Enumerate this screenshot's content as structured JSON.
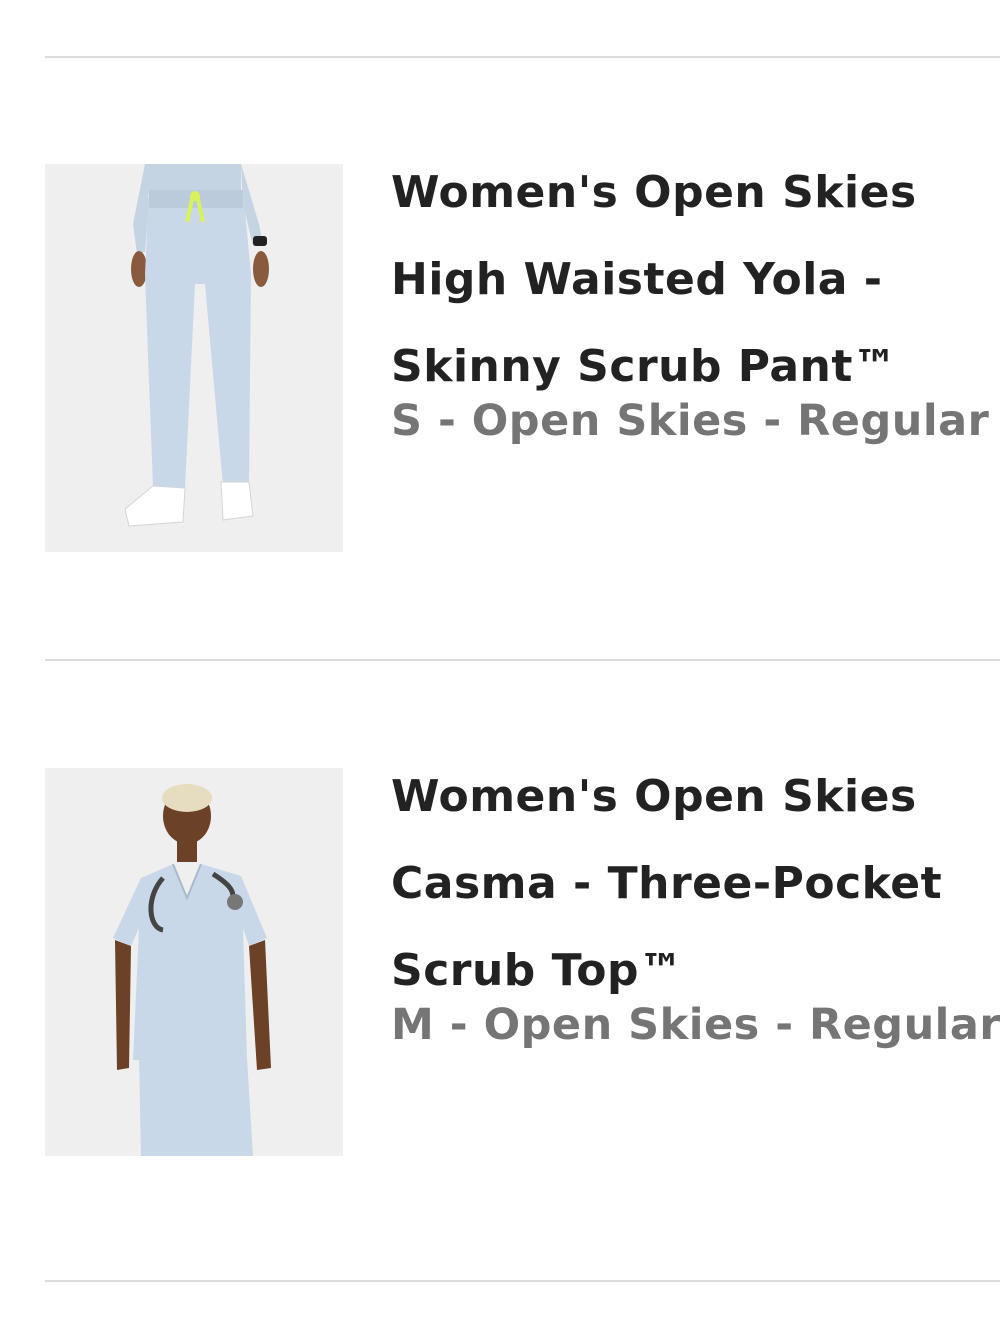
{
  "colors": {
    "title": "#222222",
    "variant": "#757575",
    "divider": "#dcdcdc",
    "scrub": "#c9d8e8",
    "thumb_bg": "#efefef",
    "drawstring": "#d8f25a"
  },
  "items": [
    {
      "title_lines": [
        "Women's Open Skies",
        "High Waisted Yola -",
        "Skinny Scrub Pant™"
      ],
      "variant": "S - Open Skies - Regular",
      "image_icon": "scrub-pants-photo"
    },
    {
      "title_lines": [
        "Women's Open Skies",
        "Casma - Three-Pocket",
        "Scrub Top™"
      ],
      "variant": "M - Open Skies - Regular",
      "image_icon": "scrub-top-photo"
    }
  ]
}
